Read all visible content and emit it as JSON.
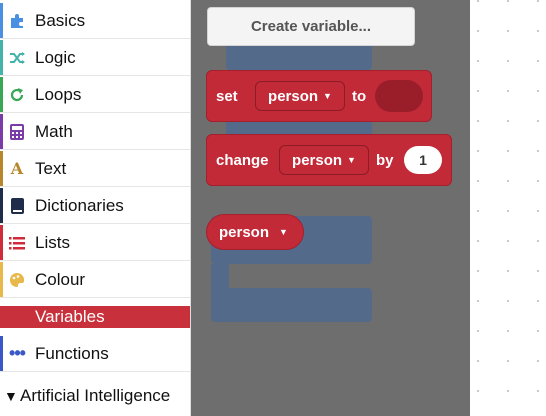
{
  "toolbox": {
    "categories": [
      {
        "label": "Basics",
        "icon": "puzzle-icon",
        "color": "#4a90e2"
      },
      {
        "label": "Logic",
        "icon": "shuffle-icon",
        "color": "#44b3a9"
      },
      {
        "label": "Loops",
        "icon": "loop-arrow-icon",
        "color": "#3aa756"
      },
      {
        "label": "Math",
        "icon": "calculator-icon",
        "color": "#7c3ca8"
      },
      {
        "label": "Text",
        "icon": "letter-a-icon",
        "color": "#b8862b"
      },
      {
        "label": "Dictionaries",
        "icon": "book-icon",
        "color": "#1f2d4a"
      },
      {
        "label": "Lists",
        "icon": "list-icon",
        "color": "#d02b3a"
      },
      {
        "label": "Colour",
        "icon": "palette-icon",
        "color": "#e8b84a"
      },
      {
        "label": "Variables",
        "icon": "",
        "color": "#c8303c"
      },
      {
        "label": "Functions",
        "icon": "dots-icon",
        "color": "#3a57c8"
      },
      {
        "label": "Artificial Intelligence",
        "icon": "triangle-down-icon",
        "color": "#000000"
      }
    ]
  },
  "flyout": {
    "create_variable_label": "Create variable...",
    "set_block": {
      "keyword": "set",
      "variable": "person",
      "to_label": "to"
    },
    "change_block": {
      "keyword": "change",
      "variable": "person",
      "by_label": "by",
      "amount": "1"
    },
    "getter_block": {
      "variable": "person"
    }
  },
  "colors": {
    "variable_block": "#c22a38",
    "flyout_bg": "#6e6e6e",
    "selected_category": "#c8303c"
  }
}
